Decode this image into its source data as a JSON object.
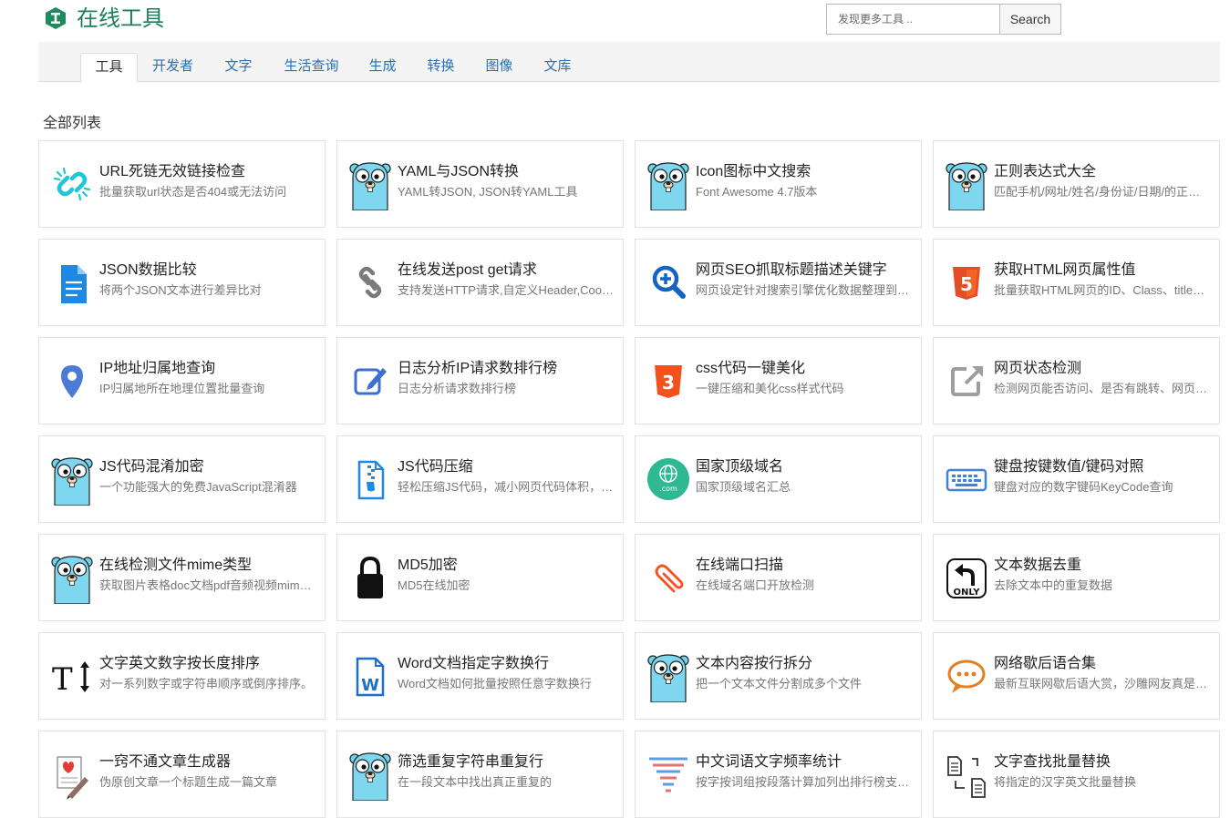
{
  "header": {
    "site_title": "在线工具",
    "search_placeholder": "发现更多工具 ..",
    "search_button": "Search"
  },
  "tabs": [
    {
      "label": "工具",
      "active": true
    },
    {
      "label": "开发者"
    },
    {
      "label": "文字"
    },
    {
      "label": "生活查询"
    },
    {
      "label": "生成"
    },
    {
      "label": "转换"
    },
    {
      "label": "图像"
    },
    {
      "label": "文库"
    }
  ],
  "section_title": "全部列表",
  "tools": [
    {
      "title": "URL死链无效链接检查",
      "desc": "批量获取url状态是否404或无法访问",
      "icon": "broken-link-icon"
    },
    {
      "title": "YAML与JSON转换",
      "desc": "YAML转JSON, JSON转YAML工具",
      "icon": "gopher-icon"
    },
    {
      "title": "Icon图标中文搜索",
      "desc": "Font Awesome 4.7版本",
      "icon": "gopher-icon"
    },
    {
      "title": "正则表达式大全",
      "desc": "匹配手机/网址/姓名/身份证/日期/的正则表达式",
      "icon": "gopher-icon"
    },
    {
      "title": "JSON数据比较",
      "desc": "将两个JSON文本进行差异比对",
      "icon": "document-icon"
    },
    {
      "title": "在线发送post get请求",
      "desc": "支持发送HTTP请求,自定义Header,Cookie",
      "icon": "chain-link-icon"
    },
    {
      "title": "网页SEO抓取标题描述关键字",
      "desc": "网页设定针对搜索引擎优化数据整理到表格",
      "icon": "zoom-in-icon"
    },
    {
      "title": "获取HTML网页属性值",
      "desc": "批量获取HTML网页的ID、Class、title等属性值",
      "icon": "html5-icon"
    },
    {
      "title": "IP地址归属地查询",
      "desc": "IP归属地所在地理位置批量查询",
      "icon": "map-pin-icon"
    },
    {
      "title": "日志分析IP请求数排行榜",
      "desc": "日志分析请求数排行榜",
      "icon": "edit-icon"
    },
    {
      "title": "css代码一键美化",
      "desc": "一键压缩和美化css样式代码",
      "icon": "css3-icon"
    },
    {
      "title": "网页状态检测",
      "desc": "检测网页能否访问、是否有跳转、网页状态码",
      "icon": "external-link-icon"
    },
    {
      "title": "JS代码混淆加密",
      "desc": "一个功能强大的免费JavaScript混淆器",
      "icon": "gopher-icon"
    },
    {
      "title": "JS代码压缩",
      "desc": "轻松压缩JS代码，减小网页代码体积，提升速度",
      "icon": "zip-file-icon"
    },
    {
      "title": "国家顶级域名",
      "desc": "国家顶级域名汇总",
      "icon": "globe-com-icon"
    },
    {
      "title": "键盘按键数值/键码对照",
      "desc": "键盘对应的数字键码KeyCode查询",
      "icon": "keyboard-icon"
    },
    {
      "title": "在线检测文件mime类型",
      "desc": "获取图片表格doc文档pdf音频视频mime类型",
      "icon": "gopher-icon"
    },
    {
      "title": "MD5加密",
      "desc": "MD5在线加密",
      "icon": "padlock-icon"
    },
    {
      "title": "在线端口扫描",
      "desc": "在线域名端口开放检测",
      "icon": "paperclip-icon"
    },
    {
      "title": "文本数据去重",
      "desc": "去除文本中的重复数据",
      "icon": "only-icon"
    },
    {
      "title": "文字英文数字按长度排序",
      "desc": "对一系列数字或字符串顺序或倒序排序。",
      "icon": "text-height-icon"
    },
    {
      "title": "Word文档指定字数换行",
      "desc": "Word文档如何批量按照任意字数换行",
      "icon": "word-icon"
    },
    {
      "title": "文本内容按行拆分",
      "desc": "把一个文本文件分割成多个文件",
      "icon": "gopher-icon"
    },
    {
      "title": "网络歇后语合集",
      "desc": "最新互联网歇后语大赏，沙雕网友真是太有才了",
      "icon": "speech-bubble-icon"
    },
    {
      "title": "一窍不通文章生成器",
      "desc": "伪原创文章一个标题生成一篇文章",
      "icon": "article-icon"
    },
    {
      "title": "筛选重复字符串重复行",
      "desc": "在一段文本中找出真正重复的",
      "icon": "gopher-icon"
    },
    {
      "title": "中文词语文字频率统计",
      "desc": "按字按词组按段落计算加列出排行榜支持导出",
      "icon": "funnel-icon"
    },
    {
      "title": "文字查找批量替换",
      "desc": "将指定的汉字英文批量替换",
      "icon": "replace-icon"
    }
  ]
}
